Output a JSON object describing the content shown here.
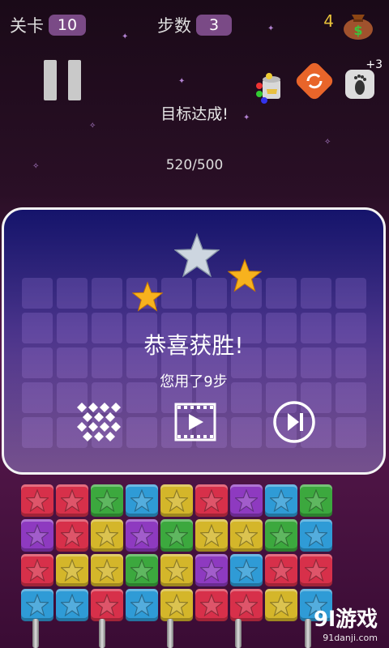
{
  "hud": {
    "level_label": "关卡",
    "level_value": "10",
    "steps_label": "步数",
    "steps_value": "3",
    "coins": "4"
  },
  "bonus": "+3",
  "goal_text": "目标达成!",
  "score": "520/500",
  "dialog": {
    "title": "恭喜获胜!",
    "subtitle": "您用了9步",
    "stars_earned": 3
  },
  "board_rows": [
    [
      "red",
      "red",
      "green",
      "blue",
      "yellow",
      "red",
      "purple",
      "blue",
      "green"
    ],
    [
      "purple",
      "red",
      "yellow",
      "purple",
      "green",
      "yellow",
      "yellow",
      "green",
      "blue"
    ],
    [
      "red",
      "yellow",
      "yellow",
      "green",
      "yellow",
      "purple",
      "blue",
      "red",
      "red"
    ],
    [
      "blue",
      "blue",
      "red",
      "blue",
      "yellow",
      "red",
      "red",
      "yellow",
      "blue"
    ]
  ],
  "tile_colors": {
    "red": "#d7304a",
    "green": "#3ca83e",
    "blue": "#2f9bd6",
    "yellow": "#d4b62a",
    "purple": "#8e3ac0"
  },
  "watermark": {
    "brand": "9l游戏",
    "site": "91danji.com"
  }
}
